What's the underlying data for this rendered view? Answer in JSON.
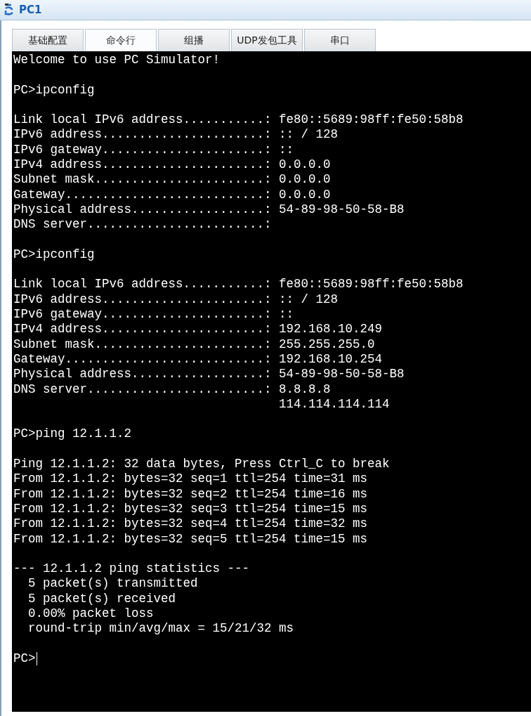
{
  "window": {
    "title": "PC1"
  },
  "tabs": [
    {
      "label": "基础配置",
      "selected": false
    },
    {
      "label": "命令行",
      "selected": true
    },
    {
      "label": "组播",
      "selected": false
    },
    {
      "label": "UDP发包工具",
      "selected": false
    },
    {
      "label": "串口",
      "selected": false
    }
  ],
  "terminal": {
    "blocks": [
      [
        "Welcome to use PC Simulator!"
      ],
      [
        "PC>ipconfig"
      ],
      [
        "Link local IPv6 address...........: fe80::5689:98ff:fe50:58b8",
        "IPv6 address......................: :: / 128",
        "IPv6 gateway......................: ::",
        "IPv4 address......................: 0.0.0.0",
        "Subnet mask.......................: 0.0.0.0",
        "Gateway...........................: 0.0.0.0",
        "Physical address..................: 54-89-98-50-58-B8",
        "DNS server........................:"
      ],
      [
        "PC>ipconfig"
      ],
      [
        "Link local IPv6 address...........: fe80::5689:98ff:fe50:58b8",
        "IPv6 address......................: :: / 128",
        "IPv6 gateway......................: ::",
        "IPv4 address......................: 192.168.10.249",
        "Subnet mask.......................: 255.255.255.0",
        "Gateway...........................: 192.168.10.254",
        "Physical address..................: 54-89-98-50-58-B8",
        "DNS server........................: 8.8.8.8",
        "                                    114.114.114.114"
      ],
      [
        "PC>ping 12.1.1.2"
      ],
      [
        "Ping 12.1.1.2: 32 data bytes, Press Ctrl_C to break",
        "From 12.1.1.2: bytes=32 seq=1 ttl=254 time=31 ms",
        "From 12.1.1.2: bytes=32 seq=2 ttl=254 time=16 ms",
        "From 12.1.1.2: bytes=32 seq=3 ttl=254 time=15 ms",
        "From 12.1.1.2: bytes=32 seq=4 ttl=254 time=32 ms",
        "From 12.1.1.2: bytes=32 seq=5 ttl=254 time=15 ms"
      ],
      [
        "--- 12.1.1.2 ping statistics ---",
        "  5 packet(s) transmitted",
        "  5 packet(s) received",
        "  0.00% packet loss",
        "  round-trip min/avg/max = 15/21/32 ms"
      ]
    ],
    "prompt": "PC>"
  }
}
